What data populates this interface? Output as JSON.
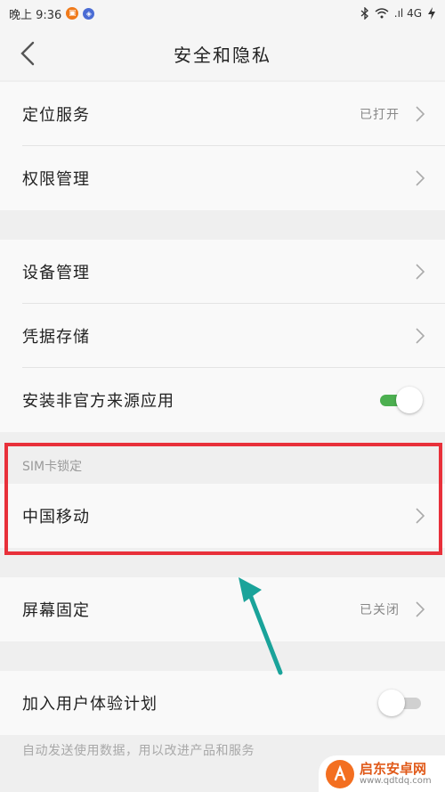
{
  "status_bar": {
    "time": "晚上 9:36",
    "network": ".ıl 4G",
    "bluetooth_icon": "bluetooth-icon",
    "wifi_icon": "wifi-icon",
    "battery_icon": "battery-charging-icon"
  },
  "header": {
    "title": "安全和隐私",
    "back_icon": "chevron-left-icon"
  },
  "group1": [
    {
      "label": "定位服务",
      "value": "已打开"
    },
    {
      "label": "权限管理",
      "value": ""
    }
  ],
  "group2": [
    {
      "label": "设备管理"
    },
    {
      "label": "凭据存储"
    },
    {
      "label": "安装非官方来源应用",
      "toggle": "on"
    }
  ],
  "sim_section": {
    "header": "SIM卡锁定",
    "item": "中国移动"
  },
  "group3": [
    {
      "label": "屏幕固定",
      "value": "已关闭"
    }
  ],
  "group4": [
    {
      "label": "加入用户体验计划",
      "toggle": "off"
    }
  ],
  "footnote": "自动发送使用数据，用以改进产品和服务",
  "watermark": {
    "title": "启东安卓网",
    "url": "www.qdtdq.com"
  },
  "colors": {
    "highlight_border": "#e8303a",
    "arrow": "#1aa39a",
    "toggle_on": "#4caf50"
  }
}
